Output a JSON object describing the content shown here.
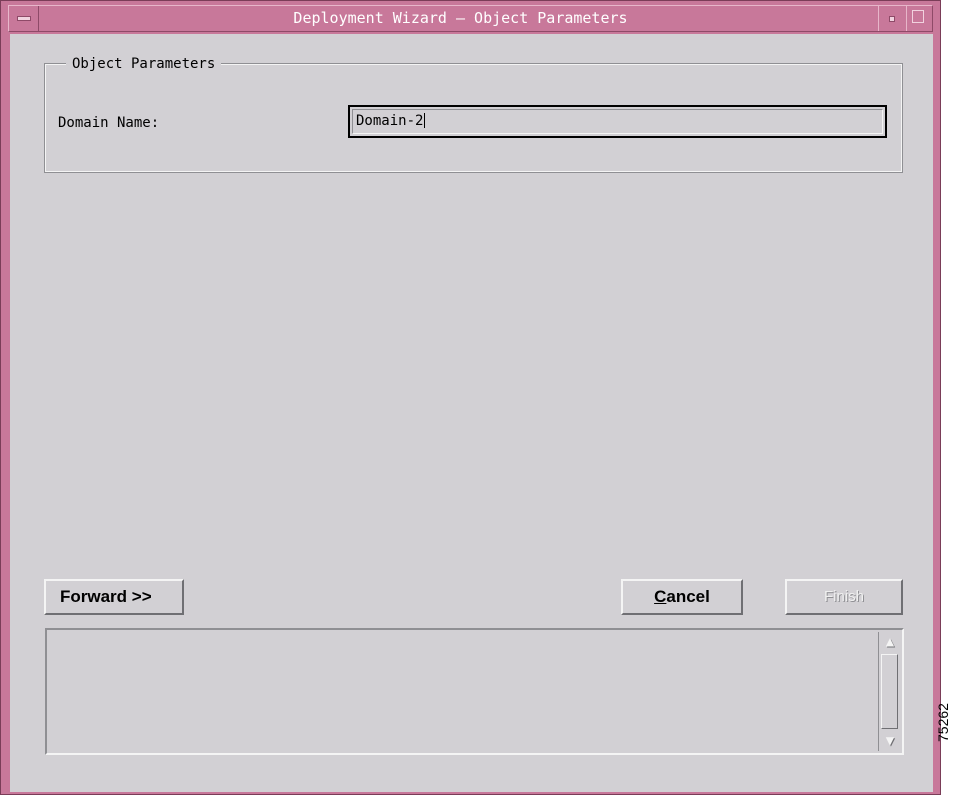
{
  "window": {
    "title": "Deployment Wizard — Object Parameters"
  },
  "object_parameters": {
    "group_label": "Object Parameters",
    "domain_name_label": "Domain Name:",
    "domain_name_value": "Domain-2"
  },
  "buttons": {
    "forward_label": "Forward >>",
    "cancel_label": "Cancel",
    "finish_label": "Finish"
  },
  "figure_id": "75262"
}
